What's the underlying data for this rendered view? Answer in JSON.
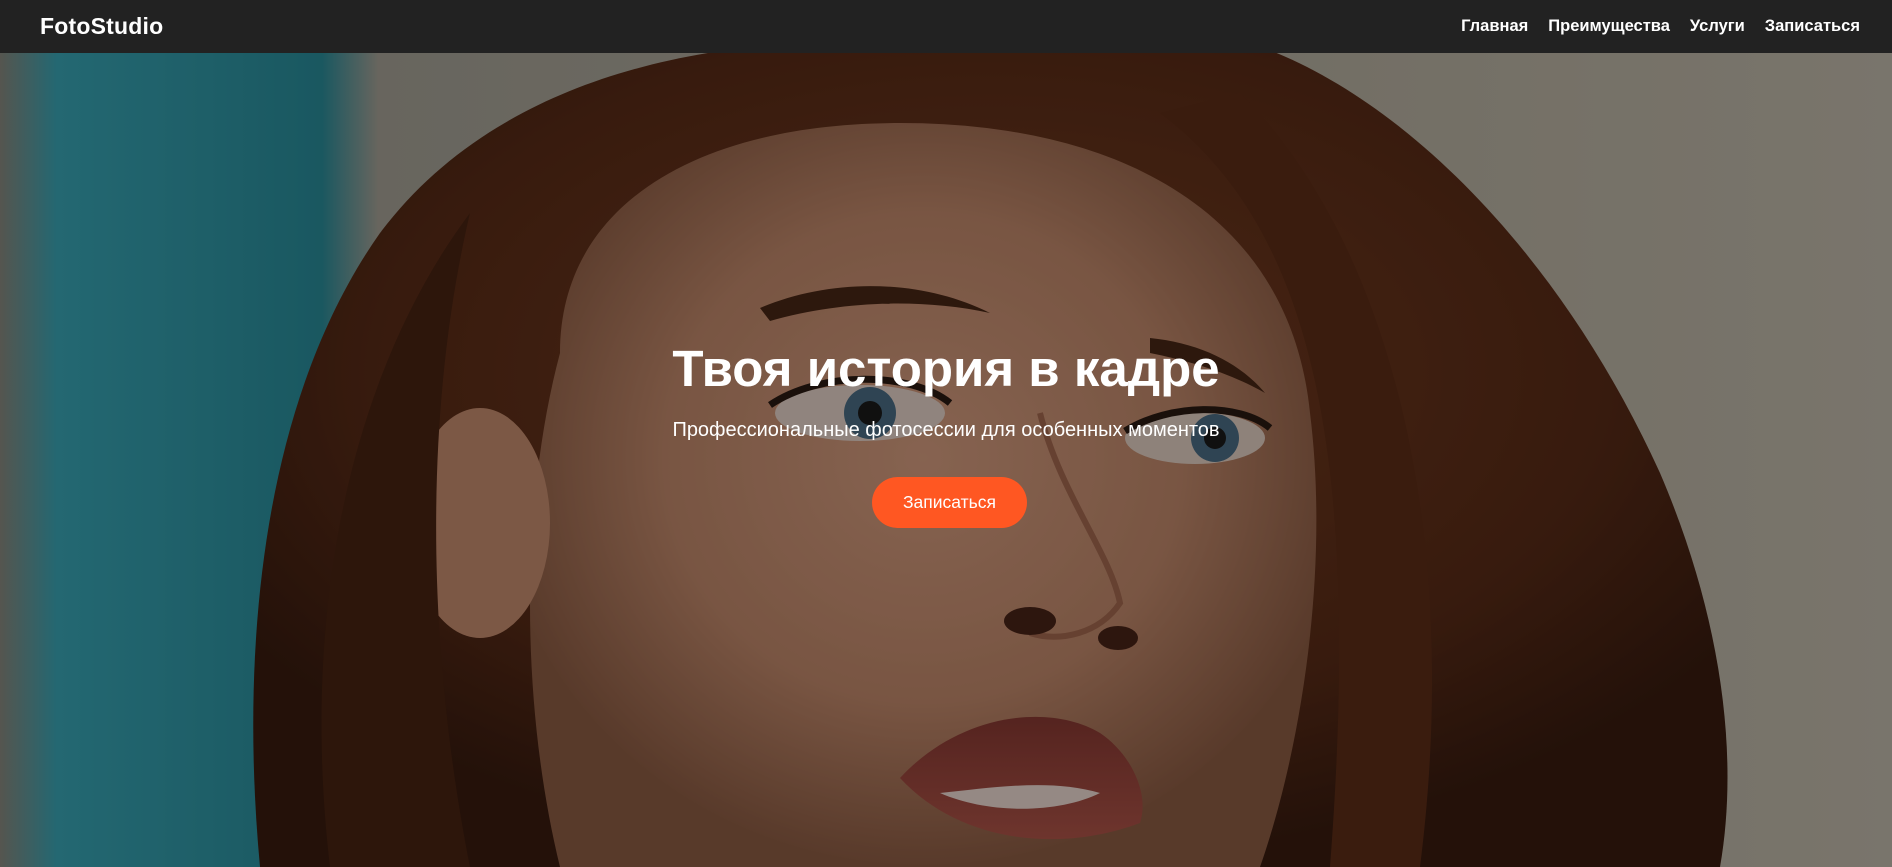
{
  "navbar": {
    "logo": "FotoStudio",
    "links": [
      {
        "label": "Главная"
      },
      {
        "label": "Преимущества"
      },
      {
        "label": "Услуги"
      },
      {
        "label": "Записаться"
      }
    ]
  },
  "hero": {
    "title": "Твоя история в кадре",
    "subtitle": "Профессиональные фотосессии для особенных моментов",
    "cta_label": "Записаться",
    "background_image": "portrait-photo-woman",
    "overlay": "dark"
  },
  "colors": {
    "navbar_bg": "#222222",
    "accent": "#ff5722",
    "text": "#ffffff"
  }
}
